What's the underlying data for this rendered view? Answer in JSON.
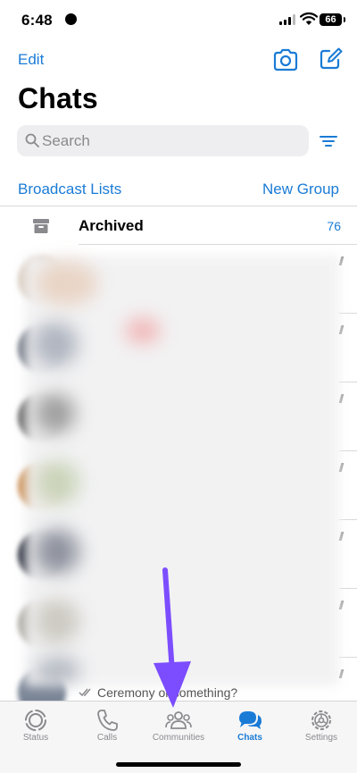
{
  "status_bar": {
    "time": "6:48",
    "battery": "66"
  },
  "header": {
    "edit_label": "Edit",
    "title": "Chats"
  },
  "search": {
    "placeholder": "Search"
  },
  "links": {
    "broadcast": "Broadcast Lists",
    "new_group": "New Group"
  },
  "archived": {
    "label": "Archived",
    "count": "76"
  },
  "chat_list": {
    "last_visible_message": "Ceremony or something?",
    "rows": 7
  },
  "tabs": [
    {
      "label": "Status",
      "icon": "status-icon",
      "active": false
    },
    {
      "label": "Calls",
      "icon": "phone-icon",
      "active": false
    },
    {
      "label": "Communities",
      "icon": "communities-icon",
      "active": false
    },
    {
      "label": "Chats",
      "icon": "chats-icon",
      "active": true
    },
    {
      "label": "Settings",
      "icon": "gear-icon",
      "active": false
    }
  ],
  "colors": {
    "accent": "#1a7bd6",
    "annotation_arrow": "#7c4dff",
    "tab_inactive": "#8a8a8e"
  }
}
